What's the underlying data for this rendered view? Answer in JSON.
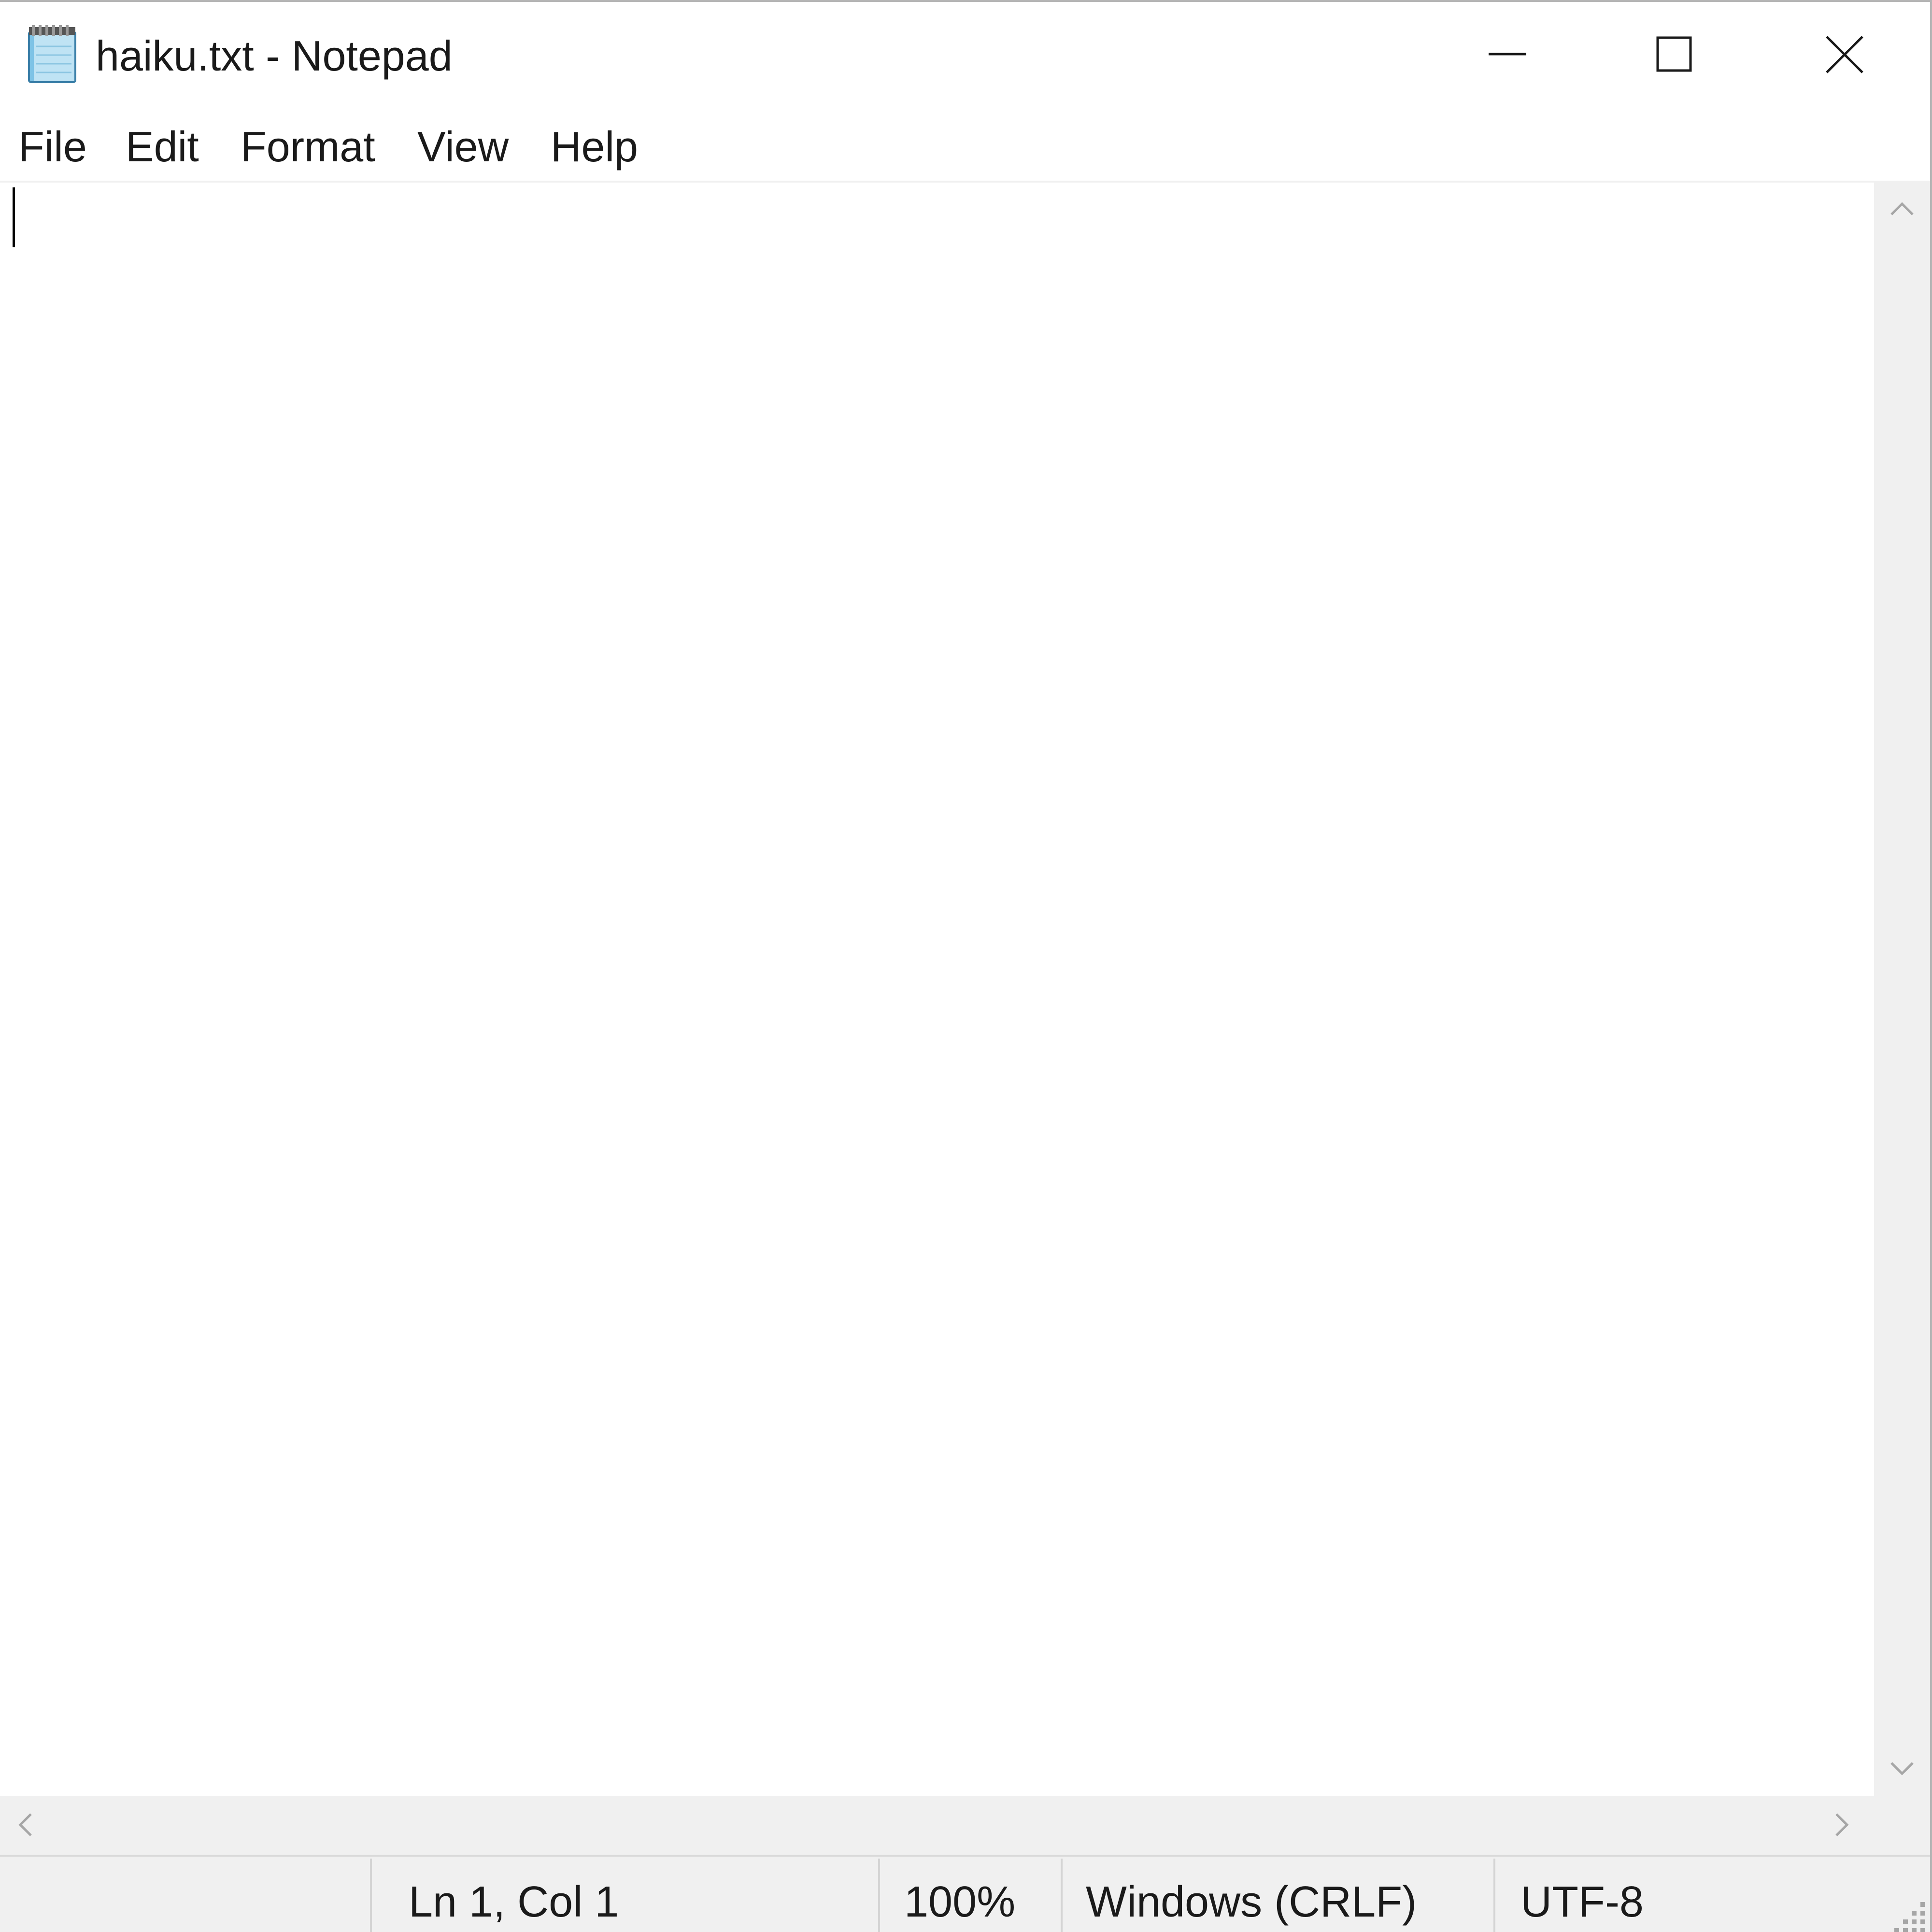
{
  "window": {
    "title": "haiku.txt - Notepad",
    "app_icon": "notepad-icon"
  },
  "title_buttons": {
    "minimize": "minimize-icon",
    "maximize": "maximize-icon",
    "close": "close-icon"
  },
  "menu": {
    "items": [
      {
        "label": "File"
      },
      {
        "label": "Edit"
      },
      {
        "label": "Format"
      },
      {
        "label": "View"
      },
      {
        "label": "Help"
      }
    ]
  },
  "editor": {
    "content": ""
  },
  "scrollbars": {
    "vertical": {
      "up": "chevron-up-icon",
      "down": "chevron-down-icon"
    },
    "horizontal": {
      "left": "chevron-left-icon",
      "right": "chevron-right-icon"
    }
  },
  "status": {
    "position": "Ln 1, Col 1",
    "zoom": "100%",
    "line_endings": "Windows (CRLF)",
    "encoding": "UTF-8"
  },
  "colors": {
    "chrome_background": "#f0f0f0",
    "editor_background": "#ffffff",
    "text": "#1a1a1a"
  }
}
